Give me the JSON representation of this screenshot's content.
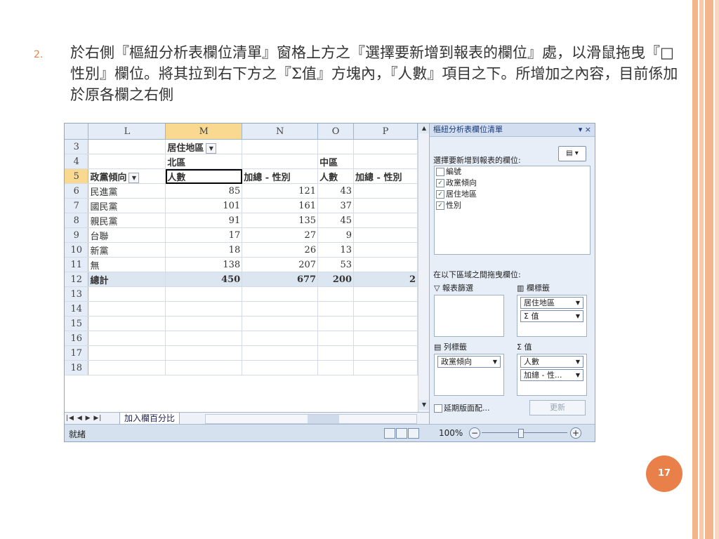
{
  "slide": {
    "bullet": "2.",
    "text": "於右側『樞紐分析表欄位清單』窗格上方之『選擇要新增到報表的欄位』處，以滑鼠拖曳『□ 性別』欄位。將其拉到右下方之『Σ值』方塊內，『人數』項目之下。所增加之內容，目前係加於原各欄之右側",
    "page_number": "17"
  },
  "sheet": {
    "columns": [
      "L",
      "M",
      "N",
      "O",
      "P"
    ],
    "rows": [
      {
        "n": "3",
        "L": "",
        "M": "居住地區",
        "N": "",
        "O": "",
        "P": ""
      },
      {
        "n": "4",
        "L": "",
        "M": "北區",
        "N": "",
        "O": "中區",
        "P": ""
      },
      {
        "n": "5",
        "L": "政黨傾向",
        "M": "人數",
        "N": "加總 - 性別",
        "O": "人數",
        "P": "加總 - 性別"
      },
      {
        "n": "6",
        "L": "民進黨",
        "M": "85",
        "N": "121",
        "O": "43",
        "P": ""
      },
      {
        "n": "7",
        "L": "國民黨",
        "M": "101",
        "N": "161",
        "O": "37",
        "P": ""
      },
      {
        "n": "8",
        "L": "親民黨",
        "M": "91",
        "N": "135",
        "O": "45",
        "P": ""
      },
      {
        "n": "9",
        "L": "台聯",
        "M": "17",
        "N": "27",
        "O": "9",
        "P": ""
      },
      {
        "n": "10",
        "L": "新黨",
        "M": "18",
        "N": "26",
        "O": "13",
        "P": ""
      },
      {
        "n": "11",
        "L": "無",
        "M": "138",
        "N": "207",
        "O": "53",
        "P": ""
      },
      {
        "n": "12",
        "L": "總計",
        "M": "450",
        "N": "677",
        "O": "200",
        "P": "2"
      },
      {
        "n": "13",
        "L": "",
        "M": "",
        "N": "",
        "O": "",
        "P": ""
      },
      {
        "n": "14",
        "L": "",
        "M": "",
        "N": "",
        "O": "",
        "P": ""
      },
      {
        "n": "15",
        "L": "",
        "M": "",
        "N": "",
        "O": "",
        "P": ""
      },
      {
        "n": "16",
        "L": "",
        "M": "",
        "N": "",
        "O": "",
        "P": ""
      },
      {
        "n": "17",
        "L": "",
        "M": "",
        "N": "",
        "O": "",
        "P": ""
      },
      {
        "n": "18",
        "L": "",
        "M": "",
        "N": "",
        "O": "",
        "P": ""
      }
    ],
    "sheet_tab": "加入欄百分比",
    "status": "就緒",
    "zoom": "100%"
  },
  "pane": {
    "title": "樞紐分析表欄位清單",
    "pick_label": "選擇要新增到報表的欄位:",
    "fields": [
      {
        "label": "編號",
        "checked": false
      },
      {
        "label": "政黨傾向",
        "checked": true
      },
      {
        "label": "居住地區",
        "checked": true
      },
      {
        "label": "性別",
        "checked": true
      }
    ],
    "drag_label": "在以下區域之間拖曳欄位:",
    "filter_title": "報表篩選",
    "col_title": "欄標籤",
    "row_title": "列標籤",
    "values_title": "值",
    "col_chips": [
      "居住地區",
      "Σ 值"
    ],
    "row_chips": [
      "政黨傾向"
    ],
    "value_chips": [
      "人數",
      "加總 - 性..."
    ],
    "defer_label": "延期版面配...",
    "update_label": "更新"
  }
}
